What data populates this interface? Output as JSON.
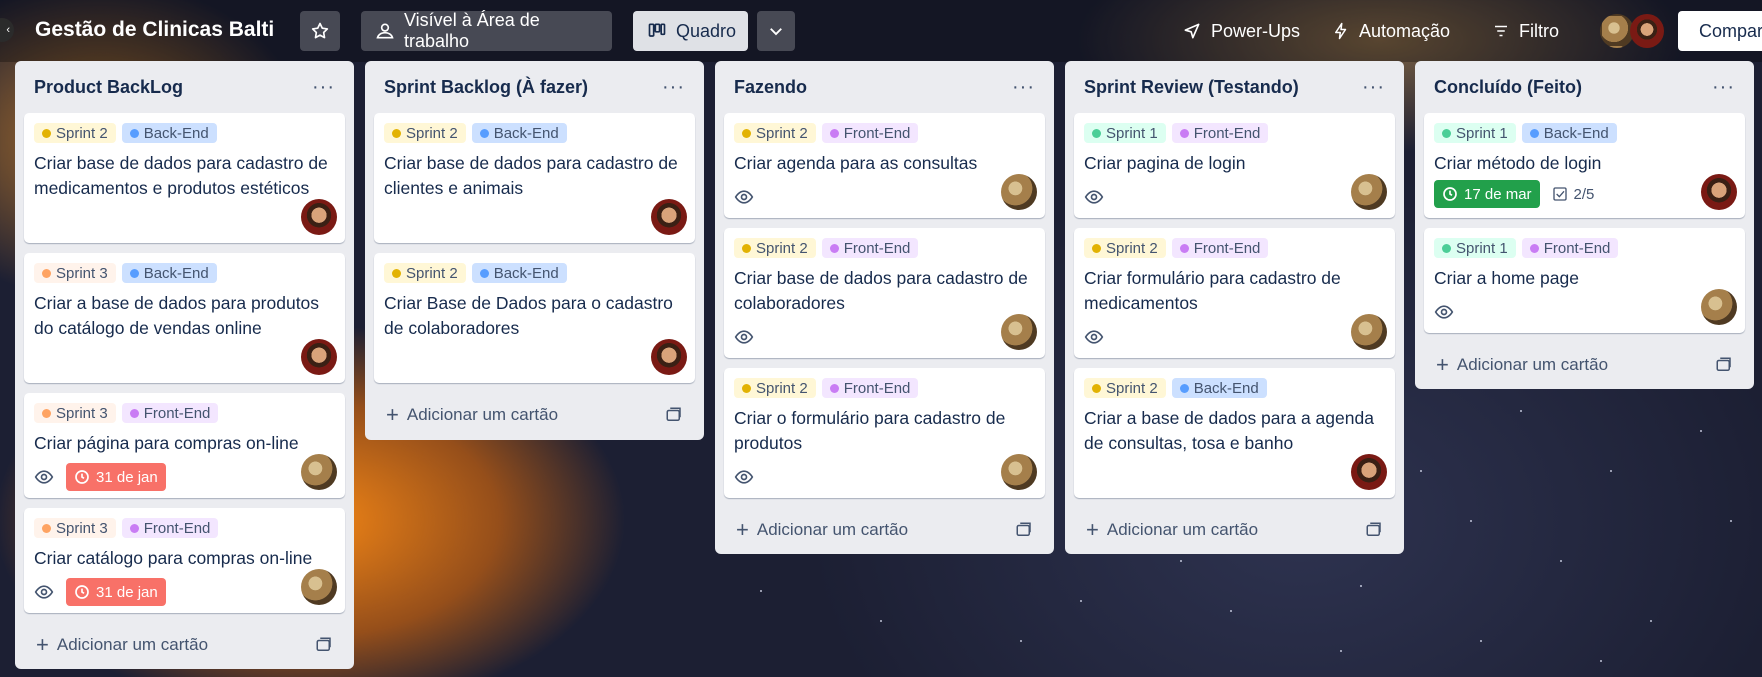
{
  "header": {
    "board_title": "Gestão de Clinicas Balti",
    "visibility_label": "Visível à Área de trabalho",
    "view_label": "Quadro",
    "powerups_label": "Power-Ups",
    "automation_label": "Automação",
    "filter_label": "Filtro",
    "share_label": "Compartilhar"
  },
  "labels": {
    "sprint1": "Sprint 1",
    "sprint2": "Sprint 2",
    "sprint3": "Sprint 3",
    "backend": "Back-End",
    "frontend": "Front-End"
  },
  "colors": {
    "sprint1_bg": "#dcfff1",
    "sprint1_dot": "#4bce97",
    "sprint2_bg": "#fff7d6",
    "sprint2_dot": "#e2b203",
    "sprint3_bg": "#fff3eb",
    "sprint3_dot": "#fea362",
    "backend_bg": "#cce0ff",
    "backend_dot": "#579dff",
    "frontend_bg": "#f3e6ff",
    "frontend_dot": "#c97cf4",
    "due_overdue": "#f87168",
    "due_complete": "#1f845a"
  },
  "lists": [
    {
      "title": "Product BackLog",
      "add_label": "Adicionar um cartão",
      "cards": [
        {
          "title": "Criar base de dados para cadastro de medicamentos e produtos estéticos"
        },
        {
          "title": "Criar a base de dados para produtos do catálogo de vendas online"
        },
        {
          "title": "Criar página para compras on-line",
          "due": "31 de jan"
        },
        {
          "title": "Criar catálogo para compras on-line",
          "due": "31 de jan"
        }
      ]
    },
    {
      "title": "Sprint Backlog (À fazer)",
      "add_label": "Adicionar um cartão",
      "cards": [
        {
          "title": "Criar base de dados para cadastro de clientes e animais"
        },
        {
          "title": "Criar Base de Dados para o cadastro de colaboradores"
        }
      ]
    },
    {
      "title": "Fazendo",
      "add_label": "Adicionar um cartão",
      "cards": [
        {
          "title": "Criar agenda para as consultas"
        },
        {
          "title": "Criar base de dados para cadastro de colaboradores"
        },
        {
          "title": "Criar o formulário para cadastro de produtos"
        }
      ]
    },
    {
      "title": "Sprint Review (Testando)",
      "add_label": "Adicionar um cartão",
      "cards": [
        {
          "title": "Criar pagina de login"
        },
        {
          "title": "Criar formulário para cadastro de medicamentos"
        },
        {
          "title": "Criar a base de dados para a agenda de consultas, tosa e banho"
        }
      ]
    },
    {
      "title": "Concluído (Feito)",
      "add_label": "Adicionar um cartão",
      "cards": [
        {
          "title": "Criar método de login",
          "due": "17 de mar",
          "checklist": "2/5"
        },
        {
          "title": "Criar a home page"
        }
      ]
    }
  ]
}
